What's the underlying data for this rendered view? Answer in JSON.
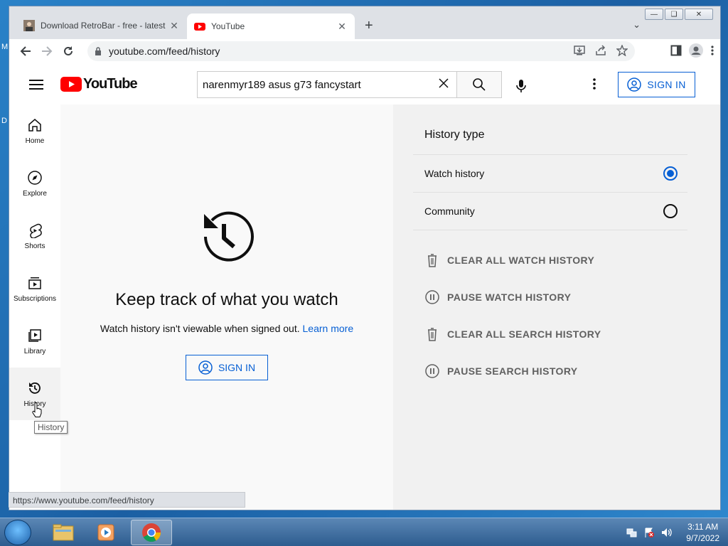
{
  "desktop": {
    "letters": [
      "M",
      "D"
    ]
  },
  "browser": {
    "tabs": [
      {
        "title": "Download RetroBar - free - latest",
        "active": false
      },
      {
        "title": "YouTube",
        "active": true
      }
    ],
    "url": "youtube.com/feed/history",
    "status_url": "https://www.youtube.com/feed/history"
  },
  "yt": {
    "logo_text": "YouTube",
    "search_value": "narenmyr189 asus g73 fancystart",
    "sign_in_label": "SIGN IN",
    "guide": [
      {
        "label": "Home",
        "icon": "home-icon"
      },
      {
        "label": "Explore",
        "icon": "explore-icon"
      },
      {
        "label": "Shorts",
        "icon": "shorts-icon"
      },
      {
        "label": "Subscriptions",
        "icon": "subscriptions-icon"
      },
      {
        "label": "Library",
        "icon": "library-icon"
      },
      {
        "label": "History",
        "icon": "history-icon",
        "selected": true
      }
    ],
    "tooltip": "History",
    "main": {
      "title": "Keep track of what you watch",
      "subtitle": "Watch history isn't viewable when signed out.",
      "learn_more": "Learn more",
      "sign_in_label": "SIGN IN"
    },
    "side": {
      "title": "History type",
      "options": [
        {
          "label": "Watch history",
          "selected": true
        },
        {
          "label": "Community",
          "selected": false
        }
      ],
      "actions": [
        {
          "label": "CLEAR ALL WATCH HISTORY",
          "icon": "trash-icon"
        },
        {
          "label": "PAUSE WATCH HISTORY",
          "icon": "pause-icon"
        },
        {
          "label": "CLEAR ALL SEARCH HISTORY",
          "icon": "trash-icon"
        },
        {
          "label": "PAUSE SEARCH HISTORY",
          "icon": "pause-icon"
        }
      ]
    }
  },
  "taskbar": {
    "time": "3:11 AM",
    "date": "9/7/2022"
  },
  "colors": {
    "yt_red": "#ff0000",
    "link_blue": "#065fd4",
    "side_bg": "#f1f1f1",
    "main_bg": "#f9f9f9"
  }
}
